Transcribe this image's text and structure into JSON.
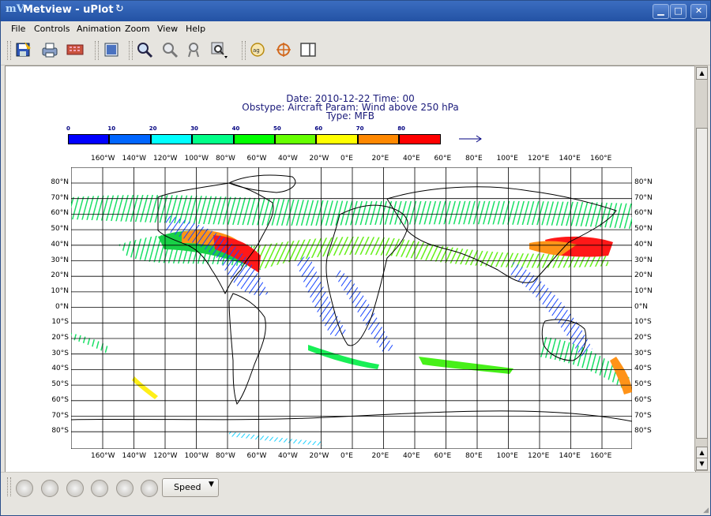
{
  "window": {
    "title": "Metview - uPlot",
    "logo": "mV"
  },
  "menu": [
    "File",
    "Controls",
    "Animation",
    "Zoom",
    "View",
    "Help"
  ],
  "toolbar_icons": [
    "save-icon",
    "print-icon",
    "export-icon",
    "layout-icon",
    "zoom-in-icon",
    "zoom-out-icon",
    "zoom-reset-icon",
    "zoom-stack-icon",
    "magnifier-icon",
    "cursor-data-icon",
    "sidebar-icon"
  ],
  "plot": {
    "title_line1": "Date: 2010-12-22 Time: 00",
    "title_line2": "Obstype: Aircraft  Param: Wind above 250 hPa",
    "title_line3": "Type: MFB",
    "legend_values": [
      "0",
      "10",
      "20",
      "30",
      "40",
      "50",
      "60",
      "70",
      "80"
    ],
    "legend_colors": [
      "#0000ff",
      "#0066ff",
      "#00ffff",
      "#00ff88",
      "#00ff00",
      "#66ff00",
      "#ffff00",
      "#ff8800",
      "#ff0000"
    ],
    "lon_labels": [
      "160°W",
      "140°W",
      "120°W",
      "100°W",
      "80°W",
      "60°W",
      "40°W",
      "20°W",
      "0°E",
      "20°E",
      "40°E",
      "60°E",
      "80°E",
      "100°E",
      "120°E",
      "140°E",
      "160°E"
    ],
    "lat_labels_left": [
      "80°N",
      "70°N",
      "60°N",
      "50°N",
      "40°N",
      "30°N",
      "20°N",
      "10°N",
      "0°N",
      "10°S",
      "20°S",
      "30°S",
      "40°S",
      "50°S",
      "60°S",
      "70°S",
      "80°S"
    ],
    "lat_labels_right": [
      "80°N",
      "70°N",
      "60°N",
      "50°N",
      "40°N",
      "30°N",
      "20°N",
      "10°N",
      "0°N",
      "10°S",
      "20°S",
      "30°S",
      "40°S",
      "50°S",
      "60°S",
      "70°S",
      "80°S"
    ]
  },
  "bottom": {
    "speed_label": "Speed"
  }
}
